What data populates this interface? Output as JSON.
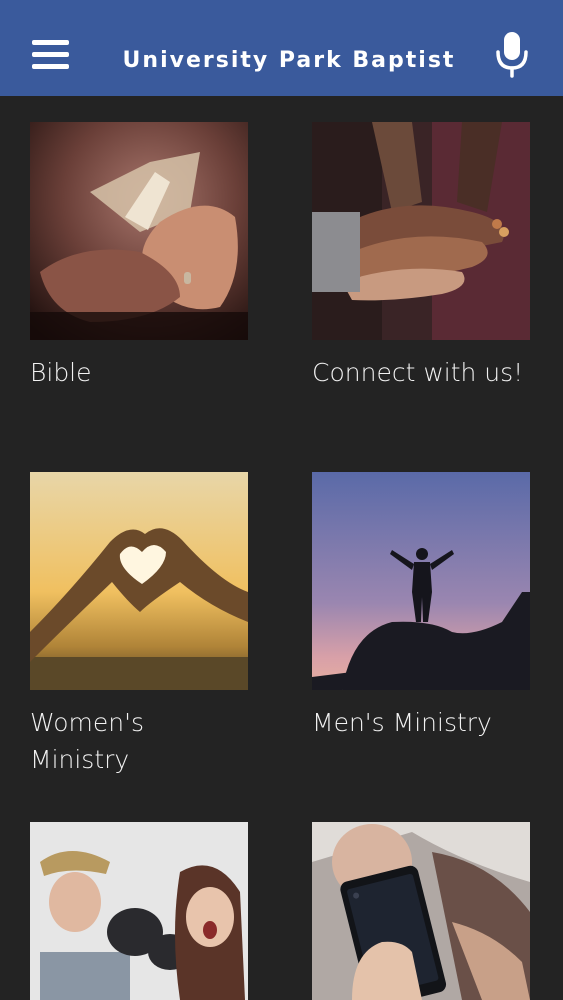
{
  "header": {
    "title": "University Park Baptist",
    "menu_icon": "hamburger-menu-icon",
    "mic_icon": "microphone-icon",
    "background_color": "#3a5a9c"
  },
  "grid": {
    "items": [
      {
        "label": "Bible",
        "image": "hands-holding-open-bible-photo"
      },
      {
        "label": "Connect with us!",
        "image": "stacked-hands-photo"
      },
      {
        "label": "Women's\nMinistry",
        "image": "heart-hands-sunset-photo"
      },
      {
        "label": "Men's Ministry",
        "image": "man-on-rock-silhouette-photo"
      },
      {
        "label": "",
        "image": "couple-boxing-gloves-photo"
      },
      {
        "label": "",
        "image": "hand-holding-smartphone-photo"
      }
    ]
  }
}
